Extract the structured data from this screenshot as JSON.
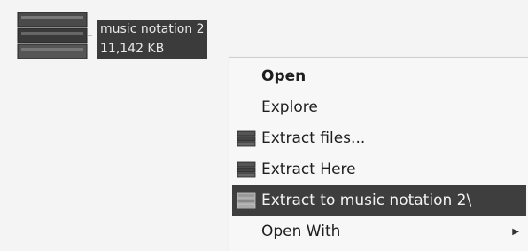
{
  "file": {
    "name": "music notation 2",
    "size": "11,142 KB",
    "icon": "rar-archive-icon"
  },
  "menu": {
    "items": [
      {
        "label": "Open",
        "bold": true
      },
      {
        "label": "Explore"
      },
      {
        "label": "Extract files...",
        "icon": "winrar-icon"
      },
      {
        "label": "Extract Here",
        "icon": "winrar-icon"
      },
      {
        "label": "Extract to music notation 2\\",
        "icon": "winrar-icon",
        "selected": true
      },
      {
        "label": "Open With",
        "submenu": true
      }
    ]
  }
}
